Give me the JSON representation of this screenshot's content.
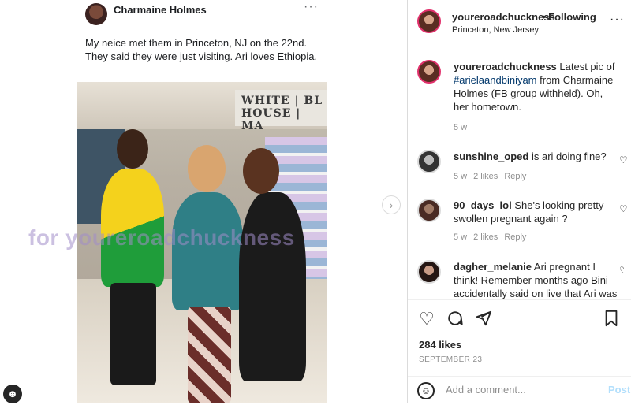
{
  "embedded_post": {
    "author": "Charmaine Holmes",
    "more": "···",
    "text": "My neice met them in Princeton, NJ on the 22nd. They said they were just visiting.   Ari loves Ethiopia.",
    "store_sign": "WHITE | BL HOUSE | MA",
    "watermark": "for   youreroadchuckness"
  },
  "nav": {
    "next_arrow": "›"
  },
  "header": {
    "username": "youreroadchuckness",
    "following": "• Following",
    "location": "Princeton, New Jersey",
    "more": "···"
  },
  "caption": {
    "username": "youreroadchuckness",
    "text_before": " Latest pic of ",
    "hashtag": "#arielaandbiniyam",
    "text_after": " from Charmaine Holmes (FB group withheld). Oh, her hometown.",
    "time": "5 w"
  },
  "comments": [
    {
      "username": "sunshine_oped",
      "text": " is ari doing fine?",
      "time": "5 w",
      "likes": "2 likes",
      "reply": "Reply"
    },
    {
      "username": "90_days_lol",
      "text": " She's looking pretty swollen pregnant again ?",
      "time": "5 w",
      "likes": "2 likes",
      "reply": "Reply"
    },
    {
      "username": "dagher_melanie",
      "text": " Ari pregnant I think! Remember months ago Bini accidentally said on live that Ari was"
    }
  ],
  "actions": {
    "likes": "284 likes",
    "date": "SEPTEMBER 23",
    "add_comment_placeholder": "Add a comment...",
    "post_label": "Post"
  },
  "icons": {
    "heart": "heart-icon",
    "comment": "comment-icon",
    "share": "share-icon",
    "bookmark": "bookmark-icon",
    "emoji": "emoji-icon"
  },
  "colors": {
    "hashtag": "#00376b",
    "story_ring": "#e1306c",
    "post_disabled": "#b2dffc"
  }
}
